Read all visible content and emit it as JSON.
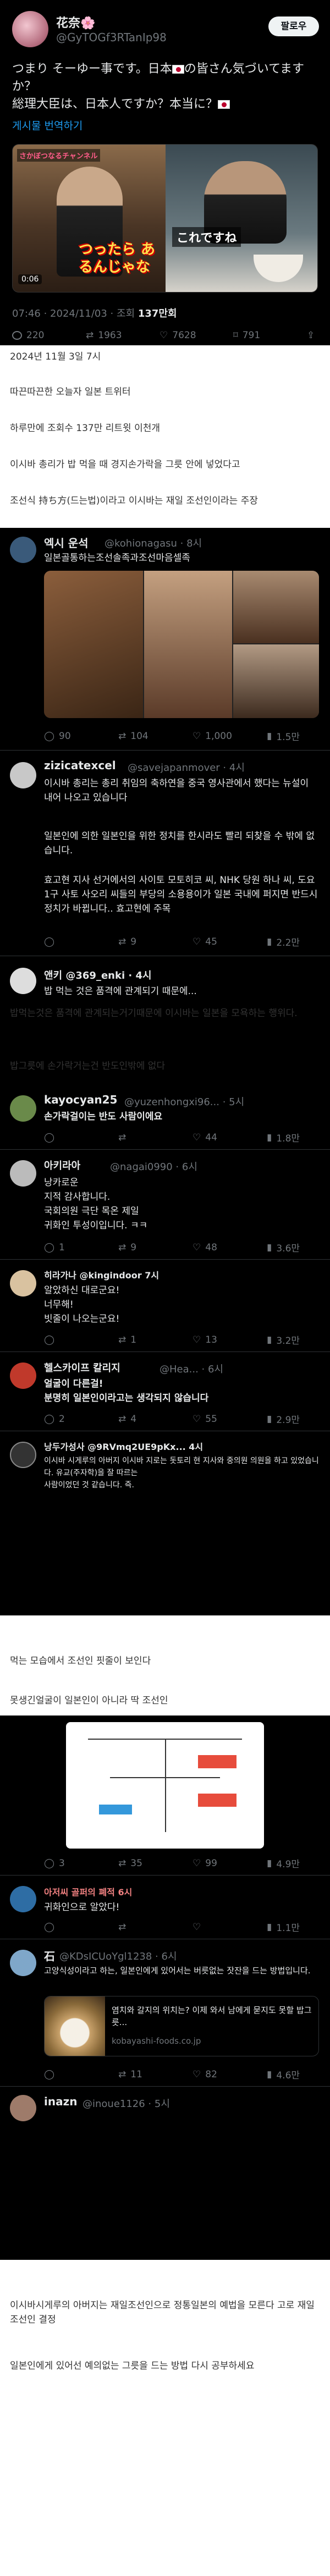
{
  "tweet": {
    "name": "花奈🌸",
    "handle": "@GyTOGf3RTanIp98",
    "follow_label": "팔로우",
    "line1": "つまり そーゆー事です。日本",
    "line1b": "の皆さん気づいてますか？",
    "line2": "総理大臣は、日本人ですか？本当に？",
    "translate": "게시물 번역하기",
    "img_top_label": "さかぼつなるチャンネル",
    "img_overlay_left": "つったら あるんじゃな",
    "img_overlay_right": "これですね",
    "img_time": "0:06",
    "meta_time": "07:46 · 2024/11/03 · 조회",
    "meta_views": "137만회",
    "stats": [
      "220",
      "1963",
      "7628",
      "791"
    ]
  },
  "article": {
    "date": "2024년 11월 3일 7시",
    "p1": "따끈따끈한 오늘자 일본 트위터",
    "p2": "하루만에 조회수 137만 리트윗 이천개",
    "p3": "이시바 총리가 밥 먹을 때 경지손가락을 그릇 안에 넣었다고",
    "p4": "조선식 持ち方(드는법)이라고 이시바는 재일 조선인이라는 주장",
    "p5": "밥먹는것은 품격에 관계되는거기때문에 이시바는 일본을 모욕하는 행위다.",
    "p6": "밥그릇에 손가락거는건 반도인밖에 없다",
    "p7": "먹는 모습에서 조선인 핏줄이 보인다",
    "p8": "못생긴얼굴이 일본인이 아니라 딱 조선인",
    "p9": "이시바시게루의 아버지는 재일조선인으로 정통일본의 예법을 모른다 고로 재일조선인 결정",
    "p10": "일본인에게 있어선 예의없는 그릇을 드는 방법 다시 공부하세요"
  },
  "reply1": {
    "name": "엑시 운석",
    "handle": "@kohionagasu · 8시",
    "text": "일본골통하는조선솔족과조선마음셀족",
    "stats": [
      "90",
      "104",
      "1,000",
      "1.5만"
    ]
  },
  "reply2": {
    "name": "zizicatexcel",
    "handle": "@savejapanmover · 4시",
    "text1": "이시바 총리는 총리 취임의 축하연을 중국 영사관에서 했다는 뉴설이 내어 나오고 있습니다",
    "text2": "일본인에 의한 일본인을 위한 정치를 한시라도 빨리 되찾을 수 밖에 없습니다.",
    "text3": "효고현 지사 선거에서의 사이토 모토히코 씨, NHK 당원 하나 씨, 도요 1구 사토 사오리 씨들의 부당의 소용용이가 일본 국내에 퍼지면 반드시 정치가 바뀝니다.. 효고현에 주목",
    "stats": [
      "",
      "9",
      "45",
      "2.2만"
    ]
  },
  "reply3": {
    "name": "앤키 @369_enki · 4시",
    "text": "밥 먹는 것은 품격에 관계되기 때문에...",
    "stats": [
      "",
      "",
      "",
      ""
    ]
  },
  "reply4": {
    "name": "kayocyan25",
    "handle": "@yuzenhongxi96... · 5시",
    "text": "손가락걸이는 반도 사람이에요",
    "stats": [
      "",
      "",
      "44",
      "1.8만"
    ]
  },
  "reply5": {
    "name": "아키라아",
    "handle": "@nagai0990 · 6시",
    "text1": "낭카로운",
    "text2": "지적 감사합니다.",
    "text3": "국회의원 극단 목온 제일",
    "text4": "귀화인 투성이입니다. ㅋㅋ",
    "stats": [
      "1",
      "9",
      "48",
      "3.6만"
    ]
  },
  "reply6": {
    "name": "히라가나 @kingindoor 7시",
    "text1": "알았하신 대로군요!",
    "text2": "너무해!",
    "text3": "빗줄이 나오는군요!",
    "stats": [
      "",
      "1",
      "13",
      "3.2만"
    ]
  },
  "reply7": {
    "name": "헬스카이프 칼리지",
    "handle": "@Hea... · 6시",
    "text1": "얼굴이 다른걸!",
    "text2": "분명히 일본인이라고는 생각되지 않습니다",
    "stats": [
      "2",
      "4",
      "55",
      "2.9만"
    ]
  },
  "reply8": {
    "name": "낭두가성사 @9RVmq2UE9pKx... 4시",
    "text1": "이시바 시게루의 아버지 이시바 지로는 돗토리 현 지사와 중의원 의원을 하고 있었습니다. 유교(주자학)을 잘 따르는",
    "text2": "사람이었던 것 같습니다. 즉.",
    "stats": [
      "",
      "",
      "",
      ""
    ]
  },
  "reply9": {
    "stats": [
      "3",
      "35",
      "99",
      "4.9만"
    ]
  },
  "reply10": {
    "name": "아저씨 골퍼의 폐적 6시",
    "text": "귀화인으로 알았다!",
    "stats": [
      "",
      "",
      "",
      "1.1만"
    ]
  },
  "reply11": {
    "name": "石",
    "handle": "@KDsICUoYgl1238 · 6시",
    "text1": "고양식성이라고 하는, 일본인에게 있어서는 버릇없는 잣잔을 드는 방법입니다.",
    "card_title": "염치와 갈지의 위치는? 이제 와서 남에게 묻지도 못할 밥그릇...",
    "card_domain": "kobayashi-foods.co.jp",
    "stats": [
      "",
      "11",
      "82",
      "4.6만"
    ]
  },
  "reply12": {
    "name": "inazn",
    "handle": "@inoue1126 · 5시"
  }
}
